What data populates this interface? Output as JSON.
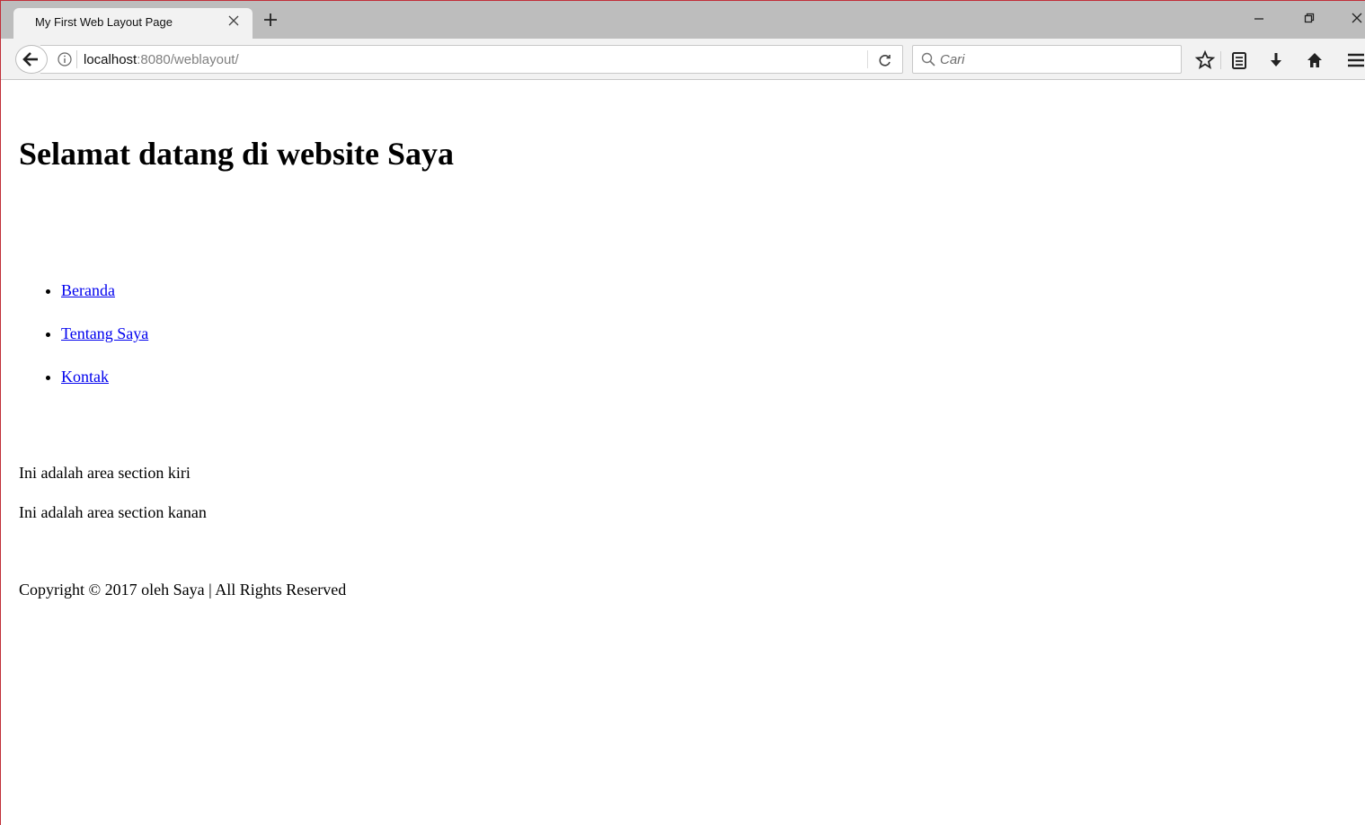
{
  "browser": {
    "tab_title": "My First Web Layout Page",
    "url_host": "localhost",
    "url_rest": ":8080/weblayout/",
    "search_placeholder": "Cari",
    "icons": {
      "close_tab": "close-icon",
      "new_tab": "plus-icon",
      "back": "arrow-left-icon",
      "info": "info-icon",
      "reload": "reload-icon",
      "search": "search-icon",
      "bookmark": "star-icon",
      "reading_list": "clipboard-icon",
      "downloads": "download-icon",
      "home": "home-icon",
      "menu": "hamburger-menu-icon",
      "minimize": "minimize-icon",
      "restore": "restore-icon",
      "close_window": "close-icon"
    },
    "accent_border": "#c0303a"
  },
  "page": {
    "heading": "Selamat datang di website Saya",
    "nav_links": [
      {
        "label": "Beranda"
      },
      {
        "label": "Tentang Saya"
      },
      {
        "label": "Kontak"
      }
    ],
    "section_left": "Ini adalah area section kiri",
    "section_right": "Ini adalah area section kanan",
    "footer": "Copyright © 2017 oleh Saya | All Rights Reserved",
    "link_color": "#0000ee"
  }
}
